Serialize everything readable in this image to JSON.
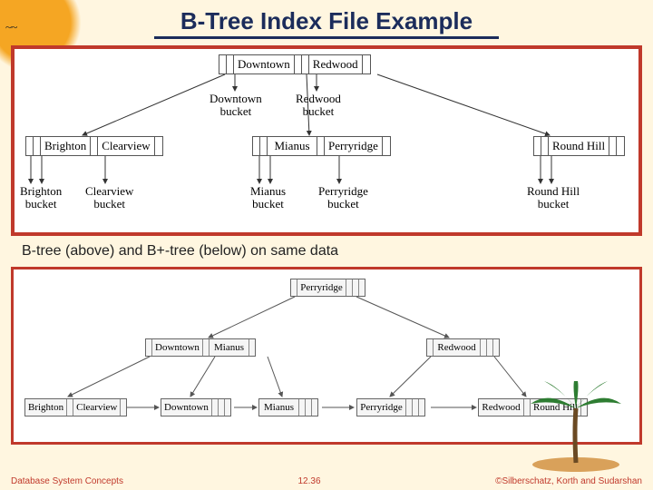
{
  "title": "B-Tree Index File Example",
  "caption": "B-tree (above) and B+-tree (below) on same data",
  "footer": {
    "left": "Database System Concepts",
    "mid": "12.36",
    "right": "©Silberschatz, Korth and Sudarshan"
  },
  "btree": {
    "root": {
      "keys": [
        "Downtown",
        "Redwood"
      ]
    },
    "root_buckets": [
      "Downtown\nbucket",
      "Redwood\nbucket"
    ],
    "leaf1": {
      "keys": [
        "Brighton",
        "Clearview"
      ]
    },
    "leaf2": {
      "keys": [
        "Mianus",
        "Perryridge"
      ]
    },
    "leaf3": {
      "keys": [
        "Round Hill"
      ]
    },
    "leaf_buckets": [
      "Brighton\nbucket",
      "Clearview\nbucket",
      "Mianus\nbucket",
      "Perryridge\nbucket",
      "Round Hill\nbucket"
    ]
  },
  "bplus": {
    "root": {
      "keys": [
        "Perryridge"
      ]
    },
    "mid": [
      {
        "keys": [
          "Downtown",
          "Mianus"
        ]
      },
      {
        "keys": [
          "Redwood"
        ]
      }
    ],
    "leaves": [
      [
        "Brighton",
        "Clearview"
      ],
      [
        "Downtown"
      ],
      [
        "Mianus"
      ],
      [
        "Perryridge"
      ],
      [
        "Redwood",
        "Round Hill"
      ]
    ]
  }
}
